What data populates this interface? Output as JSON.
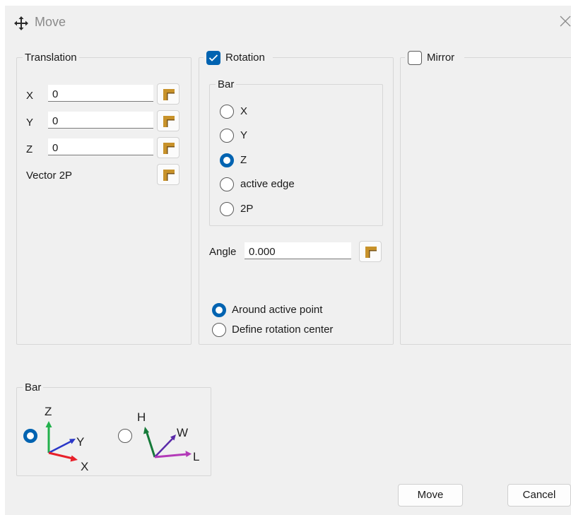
{
  "window": {
    "title": "Move"
  },
  "translation": {
    "legend": "Translation",
    "x_label": "X",
    "x_value": "0",
    "y_label": "Y",
    "y_value": "0",
    "z_label": "Z",
    "z_value": "0",
    "vector_label": "Vector 2P"
  },
  "rotation": {
    "legend": "Rotation",
    "checked": true,
    "bar": {
      "legend": "Bar",
      "options": [
        {
          "label": "X",
          "selected": false
        },
        {
          "label": "Y",
          "selected": false
        },
        {
          "label": "Z",
          "selected": true
        },
        {
          "label": "active edge",
          "selected": false
        },
        {
          "label": "2P",
          "selected": false
        }
      ]
    },
    "angle_label": "Angle",
    "angle_value": "0.000",
    "center_options": [
      {
        "label": "Around active point",
        "selected": true
      },
      {
        "label": "Define rotation center",
        "selected": false
      }
    ]
  },
  "mirror": {
    "legend": "Mirror",
    "checked": false
  },
  "bar_system": {
    "legend": "Bar",
    "option1": {
      "selected": true,
      "axis_z": "Z",
      "axis_y": "Y",
      "axis_x": "X"
    },
    "option2": {
      "selected": false,
      "axis_h": "H",
      "axis_w": "W",
      "axis_l": "L"
    }
  },
  "buttons": {
    "move": "Move",
    "cancel": "Cancel"
  },
  "colors": {
    "accent": "#0063b1",
    "pick_icon": "#c8922a"
  }
}
